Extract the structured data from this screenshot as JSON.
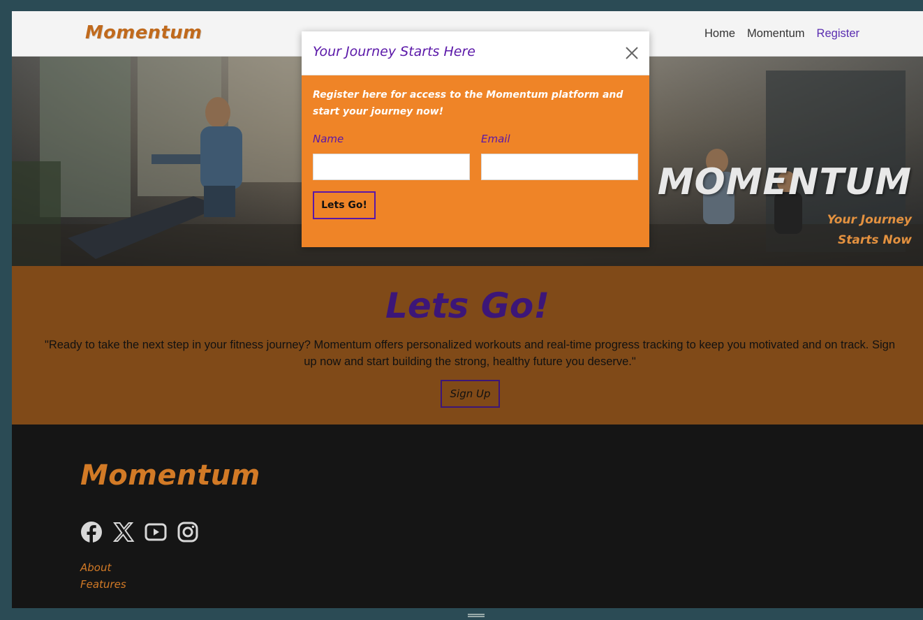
{
  "navbar": {
    "brand": "Momentum",
    "links": [
      {
        "label": "Home",
        "active": false
      },
      {
        "label": "Momentum",
        "active": false
      },
      {
        "label": "Register",
        "active": true
      }
    ]
  },
  "hero": {
    "title": "MOMENTUM",
    "subtitle": "Your Journey Starts Now"
  },
  "cta": {
    "title": "Lets Go!",
    "text": "\"Ready to take the next step in your fitness journey? Momentum offers personalized workouts and real-time progress tracking to keep you motivated and on track. Sign up now and start building the strong, healthy future you deserve.\"",
    "button": "Sign Up"
  },
  "footer": {
    "brand": "Momentum",
    "social": [
      "facebook-icon",
      "x-icon",
      "youtube-icon",
      "instagram-icon"
    ],
    "links": [
      "About",
      "Features"
    ]
  },
  "modal": {
    "title": "Your Journey Starts Here",
    "description": "Register here for access to the Momentum platform and start your journey now!",
    "name_label": "Name",
    "name_value": "",
    "email_label": "Email",
    "email_value": "",
    "submit": "Lets Go!"
  },
  "colors": {
    "orange": "#ef8427",
    "purple": "#5a17a8",
    "dark_purple": "#3c1678",
    "brown": "#804a18",
    "footer_bg": "#151515"
  }
}
